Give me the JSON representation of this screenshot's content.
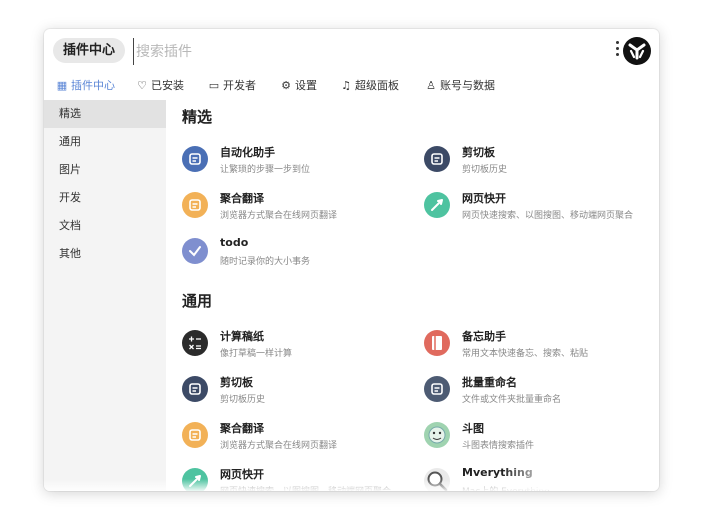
{
  "header": {
    "pill_label": "插件中心",
    "search_placeholder": "搜索插件"
  },
  "tabs": [
    {
      "icon": "grid-icon",
      "glyph": "▦",
      "label": "插件中心",
      "active": true
    },
    {
      "icon": "heart-icon",
      "glyph": "♡",
      "label": "已安装",
      "active": false
    },
    {
      "icon": "terminal-icon",
      "glyph": "▭",
      "label": "开发者",
      "active": false
    },
    {
      "icon": "gear-icon",
      "glyph": "⚙",
      "label": "设置",
      "active": false
    },
    {
      "icon": "bell-icon",
      "glyph": "♫",
      "label": "超级面板",
      "active": false
    },
    {
      "icon": "user-icon",
      "glyph": "♙",
      "label": "账号与数据",
      "active": false
    }
  ],
  "sidebar": {
    "items": [
      "精选",
      "通用",
      "图片",
      "开发",
      "文档",
      "其他"
    ],
    "active_index": 0
  },
  "sections": [
    {
      "title": "精选",
      "plugins": [
        {
          "name": "自动化助手",
          "desc": "让繁琐的步骤一步到位",
          "icon": "robot-arm-icon",
          "color": "#4a6fb5"
        },
        {
          "name": "剪切板",
          "desc": "剪切板历史",
          "icon": "clipboard-icon",
          "color": "#3c4a66"
        },
        {
          "name": "聚合翻译",
          "desc": "浏览器方式聚合在线网页翻译",
          "icon": "translate-icon",
          "color": "#f2b157"
        },
        {
          "name": "网页快开",
          "desc": "网页快速搜索、以图搜图、移动端网页聚合",
          "icon": "rocket-icon",
          "color": "#4ec3a0"
        },
        {
          "name": "todo",
          "desc": "随时记录你的大小事务",
          "icon": "check-icon",
          "color": "#7f8fcf"
        }
      ]
    },
    {
      "title": "通用",
      "plugins": [
        {
          "name": "计算稿纸",
          "desc": "像打草稿一样计算",
          "icon": "calculator-icon",
          "color": "#2b2b2b"
        },
        {
          "name": "备忘助手",
          "desc": "常用文本快速备忘、搜索、粘贴",
          "icon": "notebook-icon",
          "color": "#e06a5e"
        },
        {
          "name": "剪切板",
          "desc": "剪切板历史",
          "icon": "clipboard-icon",
          "color": "#3c4a66"
        },
        {
          "name": "批量重命名",
          "desc": "文件或文件夹批量重命名",
          "icon": "rename-icon",
          "color": "#4d5b73"
        },
        {
          "name": "聚合翻译",
          "desc": "浏览器方式聚合在线网页翻译",
          "icon": "translate-icon",
          "color": "#f2b157"
        },
        {
          "name": "斗图",
          "desc": "斗图表情搜索插件",
          "icon": "meme-face-icon",
          "color": "#9fd3b0"
        },
        {
          "name": "网页快开",
          "desc": "网页快速搜索、以图搜图、移动端网页聚合",
          "icon": "rocket-icon",
          "color": "#4ec3a0"
        },
        {
          "name": "Mverything",
          "desc": "Mac上的 Everything",
          "icon": "magnifier-icon",
          "color": "#eaeaea"
        }
      ]
    }
  ]
}
